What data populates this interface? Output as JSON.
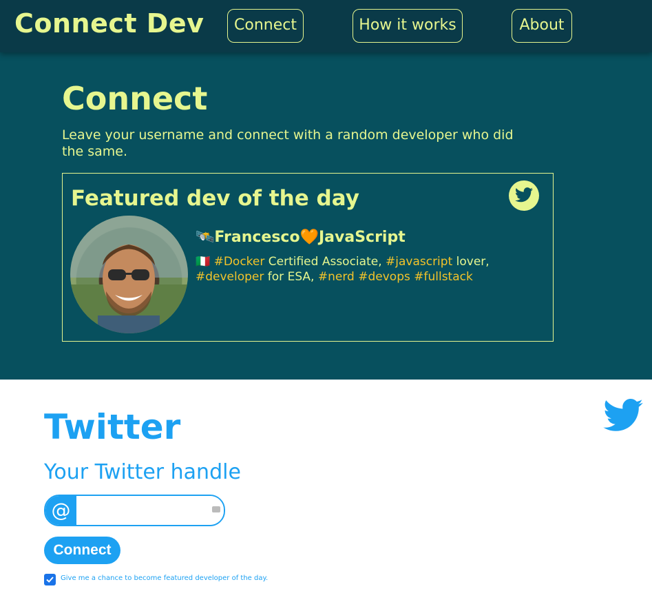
{
  "nav": {
    "brand": "Connect Dev",
    "items": [
      {
        "label": "Connect"
      },
      {
        "label": "How it works"
      },
      {
        "label": "About"
      }
    ]
  },
  "hero": {
    "title": "Connect",
    "description": "Leave your username and connect with a random developer who did the same.",
    "featured": {
      "title": "Featured dev of the day",
      "twitter_icon": "twitter-icon",
      "name": "🛰️Francesco🧡JavaScript",
      "bio": {
        "flag": "🇮🇹",
        "tag_docker": "#Docker",
        "text_1": " Certified Associate, ",
        "tag_javascript": "#javascript",
        "text_2": " lover, ",
        "tag_developer": "#developer",
        "text_3": " for ESA, ",
        "tag_nerd": "#nerd",
        "tag_devops": "#devops",
        "tag_fullstack": "#fullstack"
      }
    }
  },
  "twitter": {
    "title": "Twitter",
    "subtitle": "Your Twitter handle",
    "at_symbol": "@",
    "handle_value": "",
    "connect_label": "Connect",
    "checkbox_checked": true,
    "checkbox_label": "Give me a chance to become featured developer of the day."
  },
  "colors": {
    "nav_bg": "#0a3a48",
    "hero_bg": "#07505e",
    "accent": "#e6f68f",
    "tag": "#f2c32a",
    "twitter_blue": "#1da1f2"
  }
}
